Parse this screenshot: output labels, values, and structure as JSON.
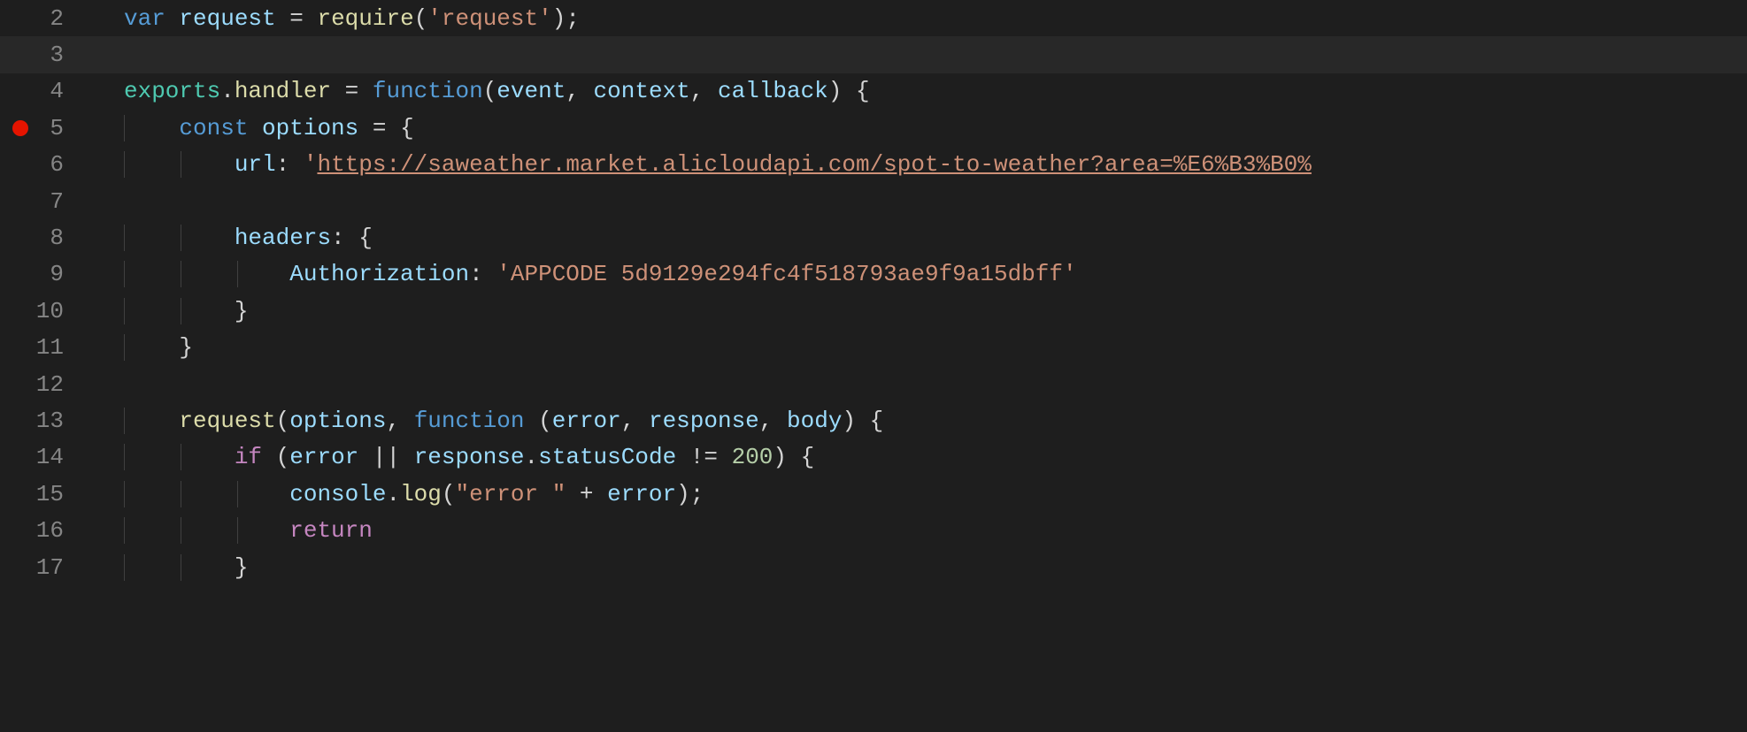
{
  "lines": {
    "n2": "2",
    "n3": "3",
    "n4": "4",
    "n5": "5",
    "n6": "6",
    "n7": "7",
    "n8": "8",
    "n9": "9",
    "n10": "10",
    "n11": "11",
    "n12": "12",
    "n13": "13",
    "n14": "14",
    "n15": "15",
    "n16": "16",
    "n17": "17"
  },
  "code": {
    "l2": {
      "var": "var",
      "request": " request ",
      "eq": "= ",
      "require": "require",
      "lp": "(",
      "str": "'request'",
      "rp": ")",
      "semi": ";"
    },
    "l4": {
      "exports": "exports",
      "dot1": ".",
      "handler": "handler",
      "sp_eq": " = ",
      "function": "function",
      "lp": "(",
      "event": "event",
      "c1": ", ",
      "context": "context",
      "c2": ", ",
      "callback": "callback",
      "rp": ")",
      "brace": " {"
    },
    "l5": {
      "indent": "    ",
      "const": "const",
      "sp": " ",
      "options": "options",
      "eq": " = ",
      "brace": "{"
    },
    "l6": {
      "indent": "        ",
      "url": "url",
      "colon": ": ",
      "q1": "'",
      "str": "https://saweather.market.alicloudapi.com/spot-to-weather?area=%E6%B3%B0%"
    },
    "l8": {
      "indent": "        ",
      "headers": "headers",
      "colon": ": ",
      "brace": "{"
    },
    "l9": {
      "indent": "            ",
      "auth": "Authorization",
      "colon": ": ",
      "str": "'APPCODE 5d9129e294fc4f518793ae9f9a15dbff'"
    },
    "l10": {
      "indent": "        ",
      "brace": "}"
    },
    "l11": {
      "indent": "    ",
      "brace": "}"
    },
    "l13": {
      "indent": "    ",
      "request": "request",
      "lp": "(",
      "options": "options",
      "c1": ", ",
      "function": "function",
      "sp": " ",
      "lp2": "(",
      "error": "error",
      "c2": ", ",
      "response": "response",
      "c3": ", ",
      "body": "body",
      "rp": ")",
      "brace": " {"
    },
    "l14": {
      "indent": "        ",
      "if": "if",
      "sp": " ",
      "lp": "(",
      "error": "error",
      "or": " || ",
      "response": "response",
      "dot": ".",
      "statusCode": "statusCode",
      "neq": " != ",
      "num": "200",
      "rp": ")",
      "brace": " {"
    },
    "l15": {
      "indent": "            ",
      "console": "console",
      "dot": ".",
      "log": "log",
      "lp": "(",
      "str": "\"error \"",
      "plus": " + ",
      "error": "error",
      "rp": ")",
      "semi": ";"
    },
    "l16": {
      "indent": "            ",
      "return": "return"
    },
    "l17": {
      "indent": "        ",
      "brace": "}"
    }
  },
  "breakpoint_line": 5
}
